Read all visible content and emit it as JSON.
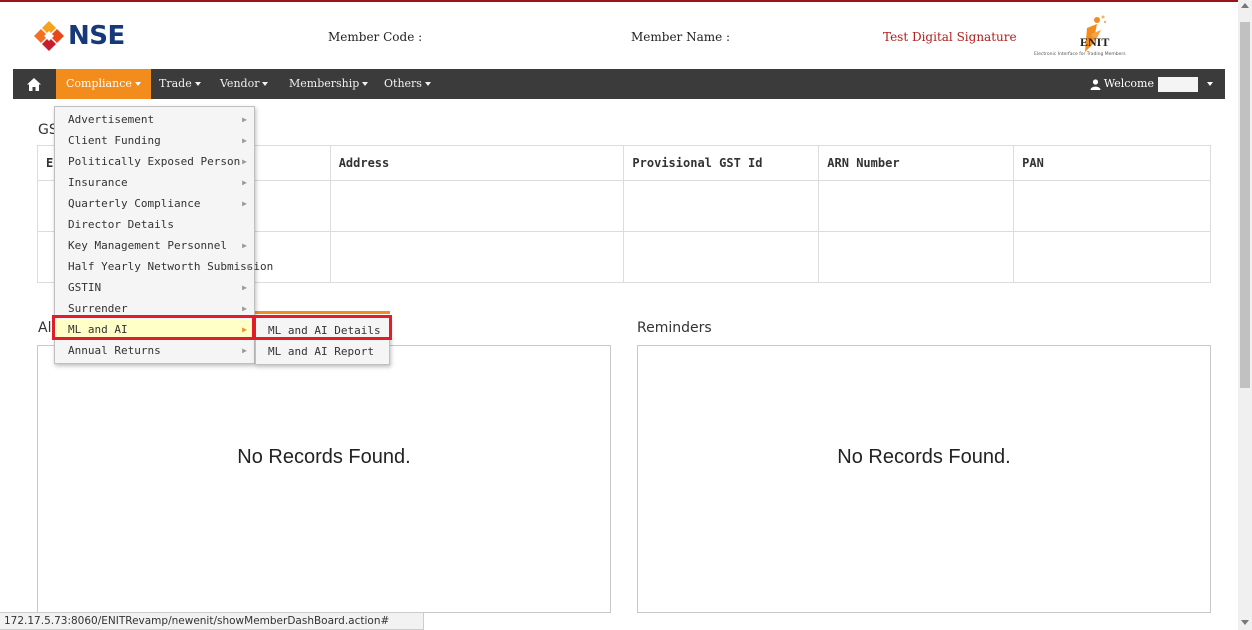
{
  "header": {
    "logo_text": "NSE",
    "member_code_label": "Member Code :",
    "member_name_label": "Member Name :",
    "signature_link": "Test Digital Signature",
    "enit_logo_text": "ENIT",
    "enit_tagline": "Electronic Interface for Trading Members",
    "colors": {
      "brand_blue": "#17397a",
      "accent_red": "#b01c1c"
    }
  },
  "navbar": {
    "items": [
      {
        "label": "Compliance",
        "active": true
      },
      {
        "label": "Trade",
        "active": false
      },
      {
        "label": "Vendor",
        "active": false
      },
      {
        "label": "Membership",
        "active": false
      },
      {
        "label": "Others",
        "active": false
      }
    ],
    "welcome_label": "Welcome",
    "home_icon": "home-icon",
    "colors": {
      "bar": "#3b3b3b",
      "active": "#f28c1d"
    }
  },
  "compliance_menu": {
    "items": [
      {
        "label": "Advertisement"
      },
      {
        "label": "Client Funding"
      },
      {
        "label": "Politically Exposed Person"
      },
      {
        "label": "Insurance"
      },
      {
        "label": "Quarterly Compliance"
      },
      {
        "label": "Director Details"
      },
      {
        "label": "Key Management Personnel"
      },
      {
        "label": "Half Yearly Networth Submission"
      },
      {
        "label": "GSTIN"
      },
      {
        "label": "Surrender"
      },
      {
        "label": "ML and AI"
      },
      {
        "label": "Annual Returns"
      }
    ],
    "highlighted": "ML and AI"
  },
  "ml_ai_submenu": {
    "items": [
      {
        "label": "ML and AI Details"
      },
      {
        "label": "ML and AI Report"
      }
    ]
  },
  "gst_section": {
    "title_partial": "GS",
    "first_header_partial": "E",
    "headers": [
      "Address",
      "Provisional GST Id",
      "ARN Number",
      "PAN"
    ]
  },
  "alerts_section": {
    "title_partial": "Al",
    "empty_text": "No Records Found."
  },
  "reminders_section": {
    "title": "Reminders",
    "empty_text": "No Records Found."
  },
  "status_bar": {
    "url": "172.17.5.73:8060/ENITRevamp/newenit/showMemberDashBoard.action#"
  }
}
